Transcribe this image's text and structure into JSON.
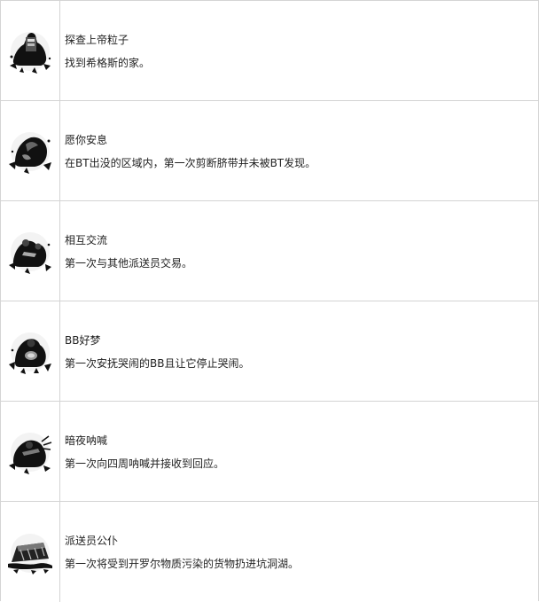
{
  "achievements": [
    {
      "icon": "porter-with-cargo-icon",
      "title": "探查上帝粒子",
      "description": "找到希格斯的家。"
    },
    {
      "icon": "hooded-figure-icon",
      "title": "愿你安息",
      "description": "在BT出没的区域内，第一次剪断脐带并未被BT发现。"
    },
    {
      "icon": "handshake-porters-icon",
      "title": "相互交流",
      "description": "第一次与其他派送员交易。"
    },
    {
      "icon": "porter-holding-bb-icon",
      "title": "BB好梦",
      "description": "第一次安抚哭闹的BB且让它停止哭闹。"
    },
    {
      "icon": "shouting-porter-icon",
      "title": "暗夜呐喊",
      "description": "第一次向四周呐喊并接收到回应。"
    },
    {
      "icon": "cargo-crate-icon",
      "title": "派送员公仆",
      "description": "第一次将受到开罗尔物质污染的货物扔进坑洞湖。"
    }
  ],
  "colors": {
    "border": "#d4d4d4",
    "text": "#222222",
    "icon_ink": "#111111"
  }
}
